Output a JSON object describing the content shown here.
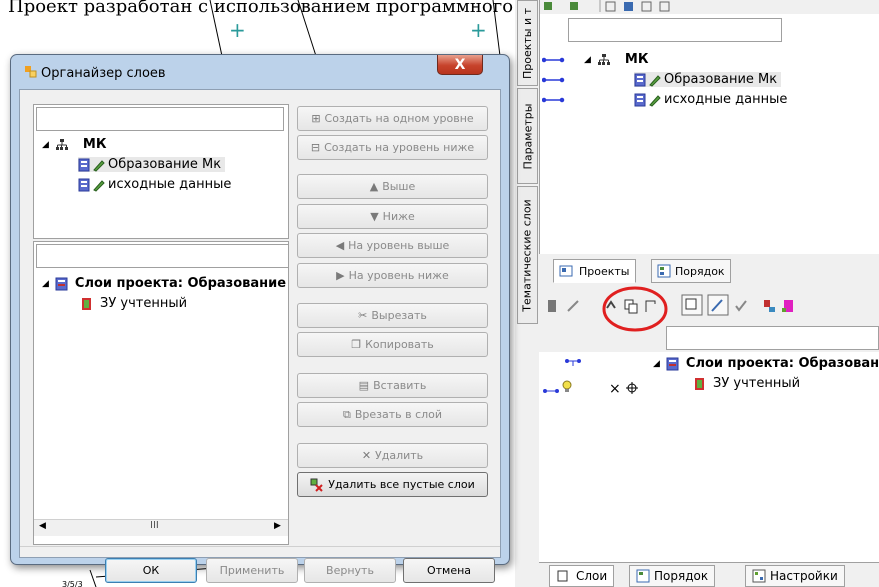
{
  "background": {
    "header_text": "Проект разработан с использованием программного комплекса (рис."
  },
  "right_panel": {
    "vertical_tabs": [
      "Проекты и т",
      "Параметры",
      "Тематические слои"
    ],
    "top_tree": {
      "root": "МК",
      "items": [
        "Образование Мк",
        "исходные данные"
      ]
    },
    "tabs": [
      "Проекты",
      "Порядок"
    ],
    "bottom_tree": {
      "root": "Слои проекта: Образован",
      "items": [
        "ЗУ учтенный"
      ]
    },
    "bottom_tabs": [
      "Слои",
      "Порядок",
      "Настройки"
    ]
  },
  "dialog": {
    "title": "Органайзер слоев",
    "close_label": "X",
    "top_tree": {
      "root": "МК",
      "items": [
        "Образование Мк",
        "исходные данные"
      ]
    },
    "bottom_tree": {
      "root": "Слои проекта: Образование I",
      "items": [
        "ЗУ учтенный"
      ]
    },
    "scroll_label": "III",
    "buttons": {
      "create_same_level": "Создать на одном уровне",
      "create_lower_level": "Создать на уровень ниже",
      "up": "Выше",
      "down": "Ниже",
      "level_up": "На уровень выше",
      "level_down": "На уровень ниже",
      "cut": "Вырезать",
      "copy": "Копировать",
      "paste": "Вставить",
      "cut_into_layer": "Врезать в слой",
      "delete": "Удалить",
      "delete_empty": "Удалить все пустые слои"
    },
    "footer": {
      "ok": "ОК",
      "apply": "Применить",
      "revert": "Вернуть",
      "cancel": "Отмена"
    }
  },
  "colors": {
    "highlight_circle": "#e02020",
    "dialog_frame": "#bcd2ea",
    "close_button": "#c7432c"
  }
}
